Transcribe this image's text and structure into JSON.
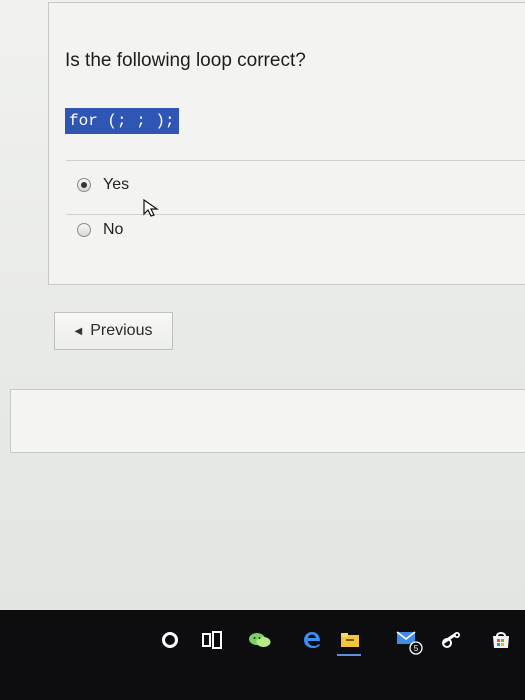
{
  "question": {
    "text": "Is the following loop correct?",
    "code": "for (; ; );"
  },
  "options": [
    {
      "label": "Yes",
      "selected": true
    },
    {
      "label": "No",
      "selected": false
    }
  ],
  "navigation": {
    "previous_label": "Previous"
  },
  "taskbar": {
    "mail_badge": "5",
    "icons": [
      "cortana-icon",
      "task-view-icon",
      "wechat-icon",
      "edge-icon",
      "file-explorer-icon",
      "mail-icon",
      "steam-icon",
      "store-icon"
    ]
  },
  "colors": {
    "code_highlight": "#2f56b4",
    "taskbar": "#0d0d10"
  }
}
